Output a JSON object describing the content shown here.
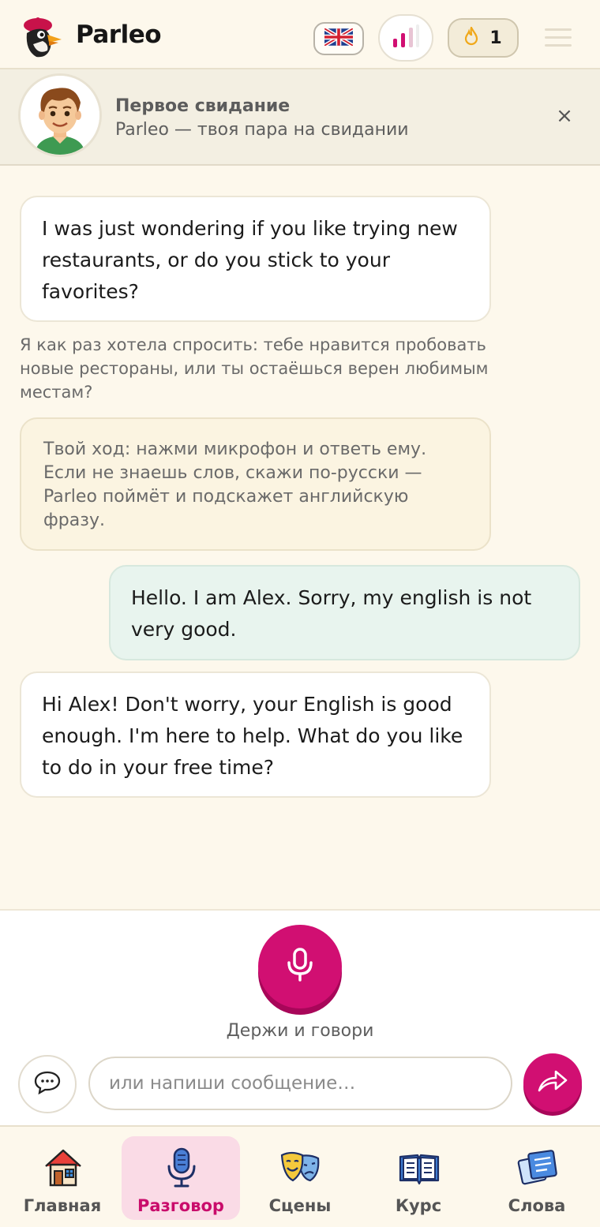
{
  "app": {
    "name": "Parleo"
  },
  "header": {
    "language_flag": "gb-flag-icon",
    "level_icon": "level-bars-icon",
    "streak_icon": "flame-icon",
    "streak_count": "1",
    "menu_icon": "hamburger-menu-icon"
  },
  "scenario": {
    "title": "Первое свидание",
    "subtitle": "Parleo — твоя пара на свидании",
    "close_label": "×"
  },
  "chat": {
    "messages": [
      {
        "role": "bot",
        "text": "I was just wondering if you like trying new restaurants, or do you stick to your favorites?"
      },
      {
        "role": "translation",
        "text": "Я как раз хотела спросить: тебе нравится пробовать новые рестораны, или ты остаёшься верен любимым местам?"
      },
      {
        "role": "hint",
        "text": "Твой ход: нажми микрофон и ответь ему. Если не знаешь слов, скажи по-русски — Parleo поймёт и подскажет английскую фразу."
      },
      {
        "role": "user",
        "text": "Hello. I am Alex. Sorry, my english is not very good."
      },
      {
        "role": "bot",
        "text": "Hi Alex! Don't worry, your English is good enough. I'm here to help. What do you like to do in your free time?"
      }
    ]
  },
  "composer": {
    "mic_label": "Держи и говори",
    "input_placeholder": "или напиши сообщение…",
    "input_value": ""
  },
  "nav": {
    "items": [
      {
        "label": "Главная",
        "icon": "home-icon",
        "active": false
      },
      {
        "label": "Разговор",
        "icon": "microphone-icon",
        "active": true
      },
      {
        "label": "Сцены",
        "icon": "theater-masks-icon",
        "active": false
      },
      {
        "label": "Курс",
        "icon": "open-book-icon",
        "active": false
      },
      {
        "label": "Слова",
        "icon": "word-cards-icon",
        "active": false
      }
    ]
  },
  "colors": {
    "accent": "#d10f72",
    "background": "#fdf8ec",
    "user_bubble": "#e8f4ee",
    "hint_bubble": "#fbf4e1",
    "active_tab": "#fadbe6"
  }
}
